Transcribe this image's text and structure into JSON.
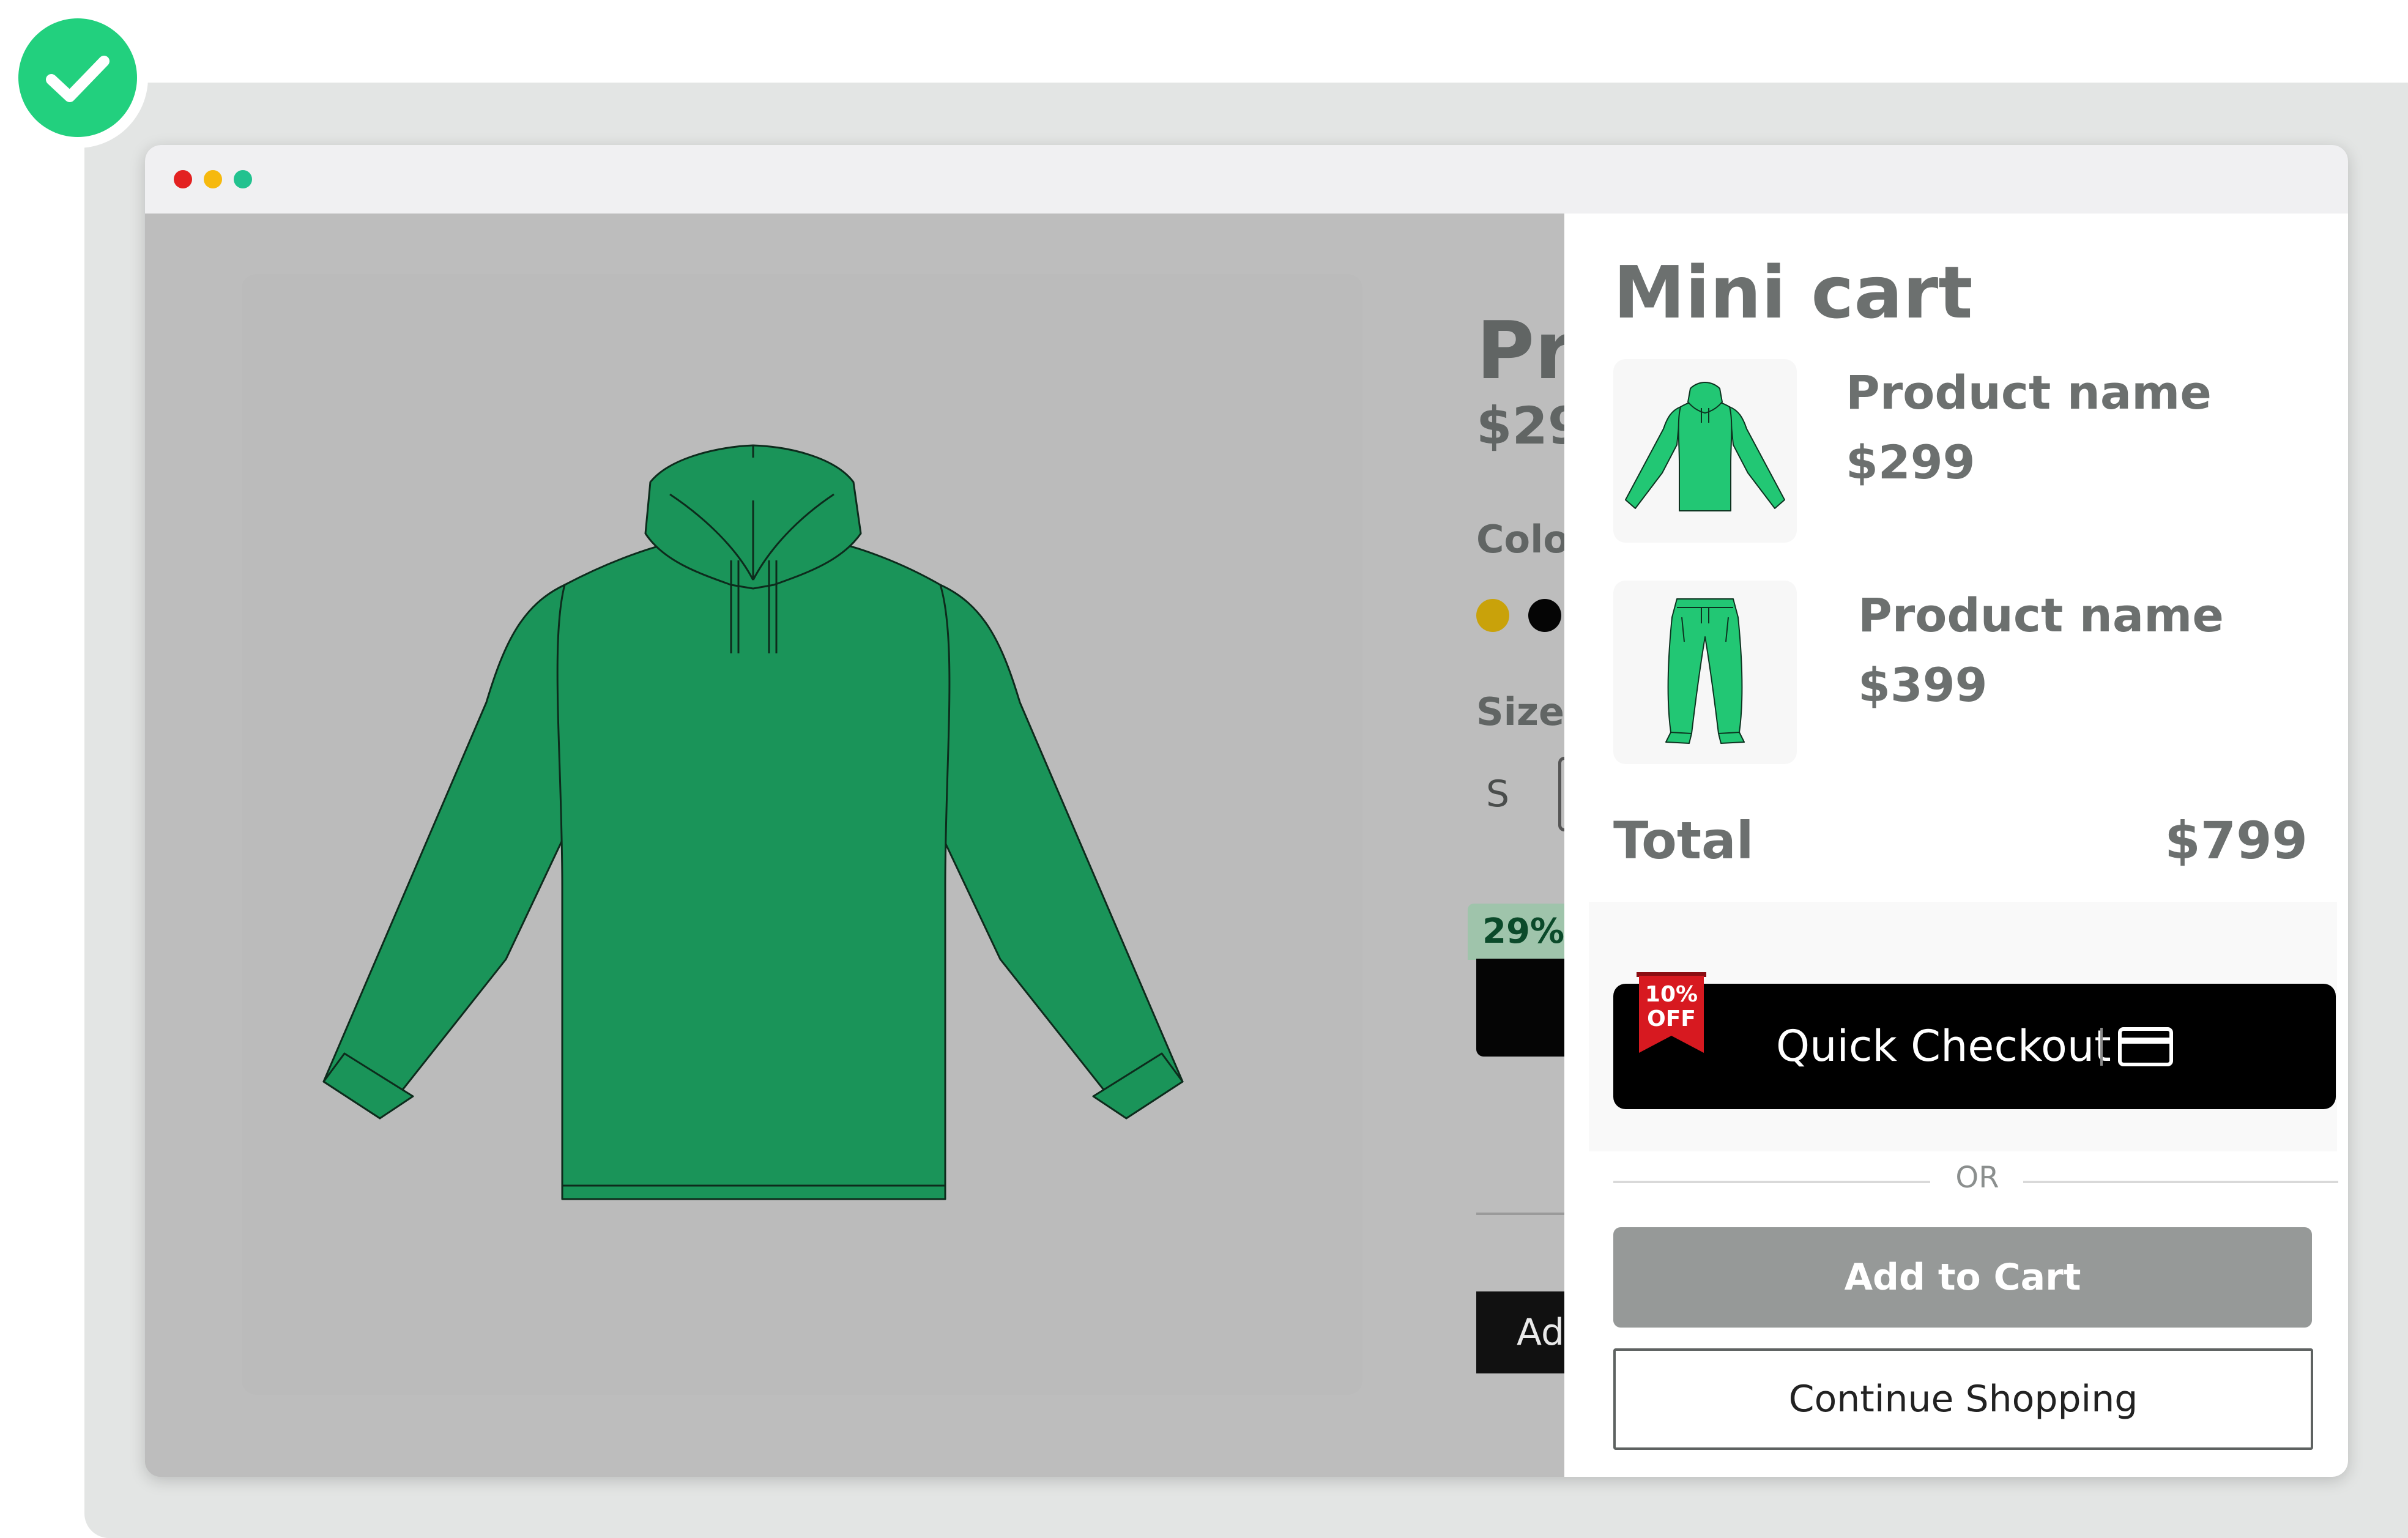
{
  "product": {
    "title": "Pr",
    "price": "$29",
    "color_label": "Colo",
    "size_label": "Size",
    "size_option": "S",
    "discount": "29%",
    "add_button_partial": "Ad"
  },
  "mini_cart": {
    "title": "Mini cart",
    "items": [
      {
        "name": "Product name",
        "price": "$299",
        "thumbnail": "hoodie-icon"
      },
      {
        "name": "Product name",
        "price": "$399",
        "thumbnail": "joggers-icon"
      }
    ],
    "total_label": "Total",
    "total_value": "$799",
    "quick_checkout": {
      "label": "Quick Checkout",
      "badge_top": "10%",
      "badge_bottom": "OFF"
    },
    "separator": "OR",
    "add_to_cart": "Add to Cart",
    "continue_shopping": "Continue Shopping"
  },
  "colors": {
    "hoodie_main": "#1a9459",
    "thumb_green": "#22c774",
    "success_badge": "#22d07e",
    "swatch_gold": "#c9a20a",
    "swatch_black": "#050505",
    "ribbon_red": "#d71920",
    "button_gray": "#969998"
  }
}
